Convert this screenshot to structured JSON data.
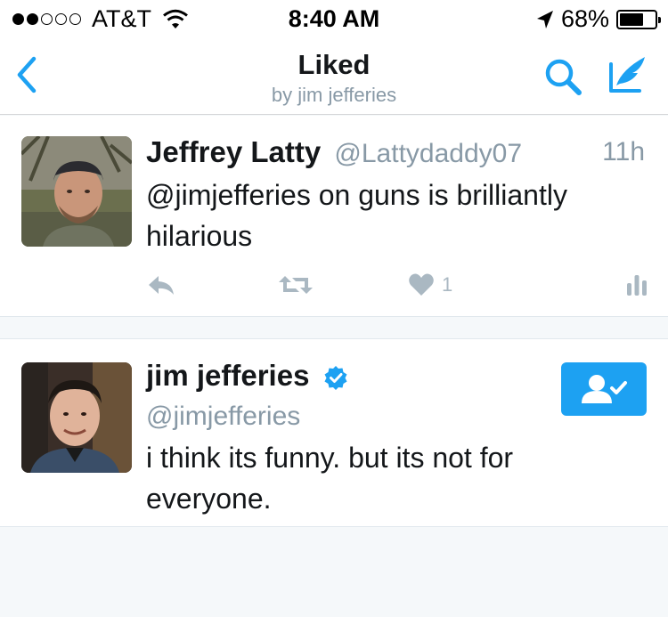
{
  "status_bar": {
    "carrier": "AT&T",
    "time": "8:40 AM",
    "battery_percent": "68%",
    "battery_level": 0.68,
    "signal_bars_filled": 2,
    "signal_bars_total": 5
  },
  "nav": {
    "title": "Liked",
    "subtitle": "by jim jefferies",
    "icons": [
      "chevron-left-icon",
      "search-icon",
      "compose-icon"
    ]
  },
  "colors": {
    "accent": "#1da1f2",
    "muted": "#8899a6",
    "icon_muted": "#aab8c2",
    "background": "#f5f8fa"
  },
  "tweets": [
    {
      "name": "Jeffrey Latty",
      "handle": "@Lattydaddy07",
      "time": "11h",
      "text": "@jimjefferies on guns is brilliantly hilarious",
      "like_count": "1",
      "actions": [
        "reply-icon",
        "retweet-icon",
        "heart-icon",
        "analytics-icon"
      ]
    },
    {
      "name": "jim jefferies",
      "handle": "@jimjefferies",
      "verified": true,
      "text": "i think its funny. but its not for everyone.",
      "follow_state": "following-icon"
    }
  ]
}
